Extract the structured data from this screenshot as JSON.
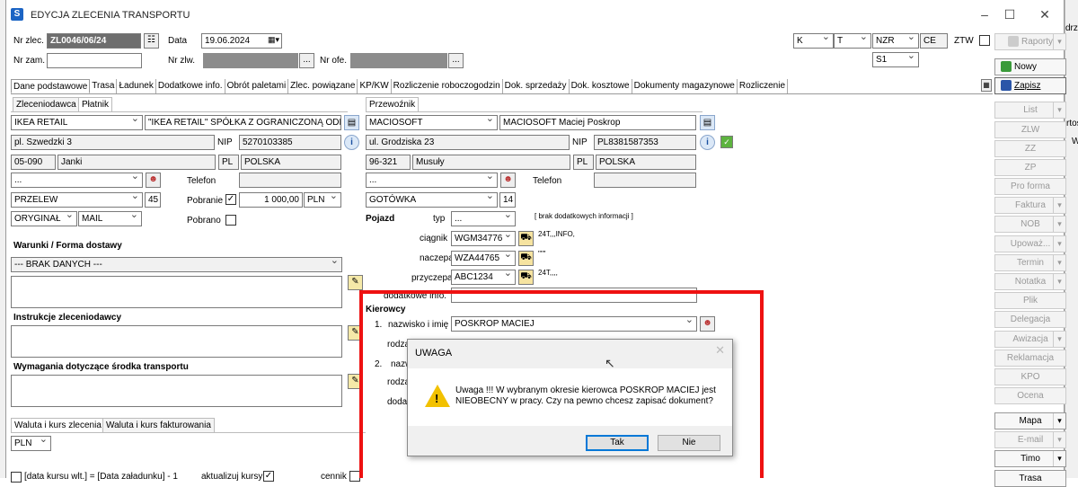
{
  "window": {
    "title": "EDYCJA ZLECENIA TRANSPORTU",
    "minimize": "–",
    "maximize": "☐",
    "close": "✕",
    "behind_text": "drz"
  },
  "header": {
    "nr_zlec_label": "Nr zlec.",
    "nr_zlec": "ZL0046/06/24",
    "data_label": "Data",
    "data": "19.06.2024",
    "nr_zam_label": "Nr zam.",
    "nr_zlw_label": "Nr zlw.",
    "nr_ofe_label": "Nr ofe.",
    "ellipsis": "...",
    "k": "K",
    "t": "T",
    "nzr": "NZR",
    "ce": "CE",
    "ztw_label": "ZTW",
    "s1": "S1"
  },
  "toolbar": {
    "raporty": "Raporty",
    "nowy": "Nowy",
    "zapisz": "Zapisz"
  },
  "tabs": [
    "Dane podstawowe",
    "Trasa",
    "Ładunek",
    "Dodatkowe info.",
    "Obrót paletami",
    "Zlec. powiązane",
    "KP/KW",
    "Rozliczenie roboczogodzin",
    "Dok. sprzedaży",
    "Dok. kosztowe",
    "Dokumenty magazynowe",
    "Rozliczenie"
  ],
  "left": {
    "tab_zleceniodawca": "Zleceniodawca",
    "tab_platnik": "Płatnik",
    "company": "IKEA RETAIL",
    "company_full": "\"IKEA RETAIL\" SPÓŁKA Z OGRANICZONĄ ODPOWI",
    "street": "pl. Szwedzki 3",
    "nip_label": "NIP",
    "nip": "5270103385",
    "postcode": "05-090",
    "city": "Janki",
    "country_code": "PL",
    "country": "POLSKA",
    "contact": "...",
    "telefon_label": "Telefon",
    "payment": "PRZELEW",
    "days": "45",
    "pobranie_label": "Pobranie",
    "pobranie_check": "✓",
    "amount": "1 000,00",
    "currency": "PLN",
    "doc_type": "ORYGINAŁ",
    "send_type": "MAIL",
    "pobrano_label": "Pobrano",
    "warunki_label": "Warunki / Forma dostawy",
    "warunki_value": "--- BRAK DANYCH ---",
    "instrukcje_label": "Instrukcje zleceniodawcy",
    "wymagania_label": "Wymagania dotyczące środka transportu",
    "tab_waluta": "Waluta i kurs zlecenia",
    "tab_waluta_fakt": "Waluta i kurs fakturowania",
    "waluta": "PLN",
    "bottom_text": "[data kursu wlt.] = [Data załadunku] - 1",
    "aktualizuj_label": "aktualizuj kursy",
    "aktualizuj_check": "✓",
    "cennik_label": "cennik"
  },
  "right": {
    "tab_przewoznik": "Przewoźnik",
    "company": "MACIOSOFT",
    "company_full": "MACIOSOFT Maciej Poskrop",
    "street": "ul. Grodziska 23",
    "nip_label": "NIP",
    "nip": "PL8381587353",
    "postcode": "96-321",
    "city": "Musuły",
    "country_code": "PL",
    "country": "POLSKA",
    "contact": "...",
    "telefon_label": "Telefon",
    "payment": "GOTÓWKA",
    "days": "14",
    "pojazd_label": "Pojazd",
    "typ_label": "typ",
    "typ_value": "...",
    "brak_info": "[ brak dodatkowych informacji ]",
    "ciagnik_label": "ciągnik",
    "ciagnik": "WGM34776",
    "ciagnik_info": "24T,,,INFO,",
    "naczepa_label": "naczepa",
    "naczepa": "WZA44765",
    "naczepa_info": "\"\"\"",
    "przyczepa_label": "przyczepa",
    "przyczepa": "ABC1234",
    "przyczepa_info": "24T,,,,",
    "dodatkowe_label": "dodatkowe info.",
    "kierowcy_label": "Kierowcy",
    "k1_num": "1.",
    "nazwisko_label": "nazwisko i imię",
    "k1_name": "POSKROP MACIEJ",
    "rodza1": "rodza",
    "k2_num": "2.",
    "nazw2": "nazw",
    "rodza2": "rodza",
    "dodat": "dodat"
  },
  "side_buttons": [
    {
      "label": "List",
      "dd": true,
      "en": false
    },
    {
      "label": "ZLW",
      "dd": false,
      "en": false
    },
    {
      "label": "ZZ",
      "dd": false,
      "en": false
    },
    {
      "label": "ZP",
      "dd": false,
      "en": false
    },
    {
      "label": "Pro forma",
      "dd": false,
      "en": false
    },
    {
      "label": "Faktura",
      "dd": true,
      "en": false
    },
    {
      "label": "NOB",
      "dd": true,
      "en": false
    },
    {
      "label": "Upoważ...",
      "dd": true,
      "en": false
    },
    {
      "label": "Termin",
      "dd": true,
      "en": false
    },
    {
      "label": "Notatka",
      "dd": true,
      "en": false
    },
    {
      "label": "Plik",
      "dd": false,
      "en": false
    },
    {
      "label": "Delegacja",
      "dd": false,
      "en": false
    },
    {
      "label": "Awizacja",
      "dd": true,
      "en": false
    },
    {
      "label": "Reklamacja",
      "dd": false,
      "en": false
    },
    {
      "label": "KPO",
      "dd": false,
      "en": false
    },
    {
      "label": "Ocena",
      "dd": false,
      "en": false
    },
    {
      "label": "Mapa",
      "dd": true,
      "en": true
    },
    {
      "label": "E-mail",
      "dd": true,
      "en": false
    },
    {
      "label": "Timo",
      "dd": true,
      "en": true
    },
    {
      "label": "Trasa",
      "dd": false,
      "en": true
    }
  ],
  "edge": {
    "right1": "rtoś",
    "right2": "W"
  },
  "dialog": {
    "title": "UWAGA",
    "close": "✕",
    "message": "Uwaga !!! W wybranym okresie kierowca POSKROP MACIEJ jest NIEOBECNY  w pracy. Czy na pewno chcesz zapisać dokument?",
    "yes": "Tak",
    "no": "Nie",
    "icon": "warning-icon"
  },
  "colors": {
    "highlight_border": "#e11111",
    "accent": "#0078d7"
  }
}
